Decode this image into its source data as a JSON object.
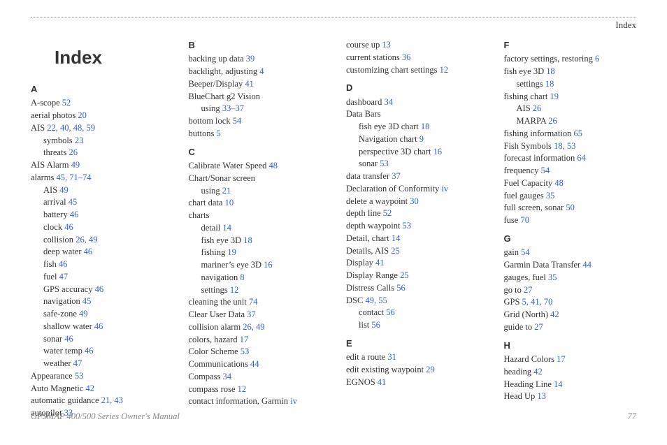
{
  "header": {
    "section": "Index"
  },
  "title": "Index",
  "footer": {
    "left": "GPSMAP 400/500 Series Owner's Manual",
    "right": "77"
  },
  "columns": [
    [
      {
        "type": "title-slot"
      },
      {
        "type": "letter",
        "text": "A"
      },
      {
        "type": "entry",
        "label": "A-scope",
        "pages": "52"
      },
      {
        "type": "entry",
        "label": "aerial photos",
        "pages": "20"
      },
      {
        "type": "entry",
        "label": "AIS",
        "pages": "22, 40, 48, 59"
      },
      {
        "type": "entry",
        "sub": true,
        "label": "symbols",
        "pages": "23"
      },
      {
        "type": "entry",
        "sub": true,
        "label": "threats",
        "pages": "26"
      },
      {
        "type": "entry",
        "label": "AIS Alarm",
        "pages": "49"
      },
      {
        "type": "entry",
        "label": "alarms",
        "pages": "45, 71–74"
      },
      {
        "type": "entry",
        "sub": true,
        "label": "AIS",
        "pages": "49"
      },
      {
        "type": "entry",
        "sub": true,
        "label": "arrival",
        "pages": "45"
      },
      {
        "type": "entry",
        "sub": true,
        "label": "battery",
        "pages": "46"
      },
      {
        "type": "entry",
        "sub": true,
        "label": "clock",
        "pages": "46"
      },
      {
        "type": "entry",
        "sub": true,
        "label": "collision",
        "pages": "26, 49"
      },
      {
        "type": "entry",
        "sub": true,
        "label": "deep water",
        "pages": "46"
      },
      {
        "type": "entry",
        "sub": true,
        "label": "fish",
        "pages": "46"
      },
      {
        "type": "entry",
        "sub": true,
        "label": "fuel",
        "pages": "47"
      },
      {
        "type": "entry",
        "sub": true,
        "label": "GPS accuracy",
        "pages": "46"
      },
      {
        "type": "entry",
        "sub": true,
        "label": "navigation",
        "pages": "45"
      },
      {
        "type": "entry",
        "sub": true,
        "label": "safe-zone",
        "pages": "49"
      },
      {
        "type": "entry",
        "sub": true,
        "label": "shallow water",
        "pages": "46"
      },
      {
        "type": "entry",
        "sub": true,
        "label": "sonar",
        "pages": "46"
      },
      {
        "type": "entry",
        "sub": true,
        "label": "water temp",
        "pages": "46"
      },
      {
        "type": "entry",
        "sub": true,
        "label": "weather",
        "pages": "47"
      },
      {
        "type": "entry",
        "label": "Appearance",
        "pages": "53"
      },
      {
        "type": "entry",
        "label": "Auto Magnetic",
        "pages": "42"
      },
      {
        "type": "entry",
        "label": "automatic guidance",
        "pages": "21, 43"
      },
      {
        "type": "entry",
        "label": "autopilot",
        "pages": "33"
      }
    ],
    [
      {
        "type": "letter",
        "text": "B"
      },
      {
        "type": "entry",
        "label": "backing up data",
        "pages": "39"
      },
      {
        "type": "entry",
        "label": "backlight, adjusting",
        "pages": "4"
      },
      {
        "type": "entry",
        "label": "Beeper/Display",
        "pages": "41"
      },
      {
        "type": "entry",
        "label": "BlueChart g2 Vision",
        "pages": ""
      },
      {
        "type": "entry",
        "sub": true,
        "label": "using",
        "pages": "33–37"
      },
      {
        "type": "entry",
        "label": "bottom lock",
        "pages": "54"
      },
      {
        "type": "entry",
        "label": "buttons",
        "pages": "5"
      },
      {
        "type": "letter",
        "text": "C"
      },
      {
        "type": "entry",
        "label": "Calibrate Water Speed",
        "pages": "48"
      },
      {
        "type": "entry",
        "label": "Chart/Sonar screen",
        "pages": ""
      },
      {
        "type": "entry",
        "sub": true,
        "label": "using",
        "pages": "21"
      },
      {
        "type": "entry",
        "label": "chart data",
        "pages": "10"
      },
      {
        "type": "entry",
        "label": "charts",
        "pages": ""
      },
      {
        "type": "entry",
        "sub": true,
        "label": "detail",
        "pages": "14"
      },
      {
        "type": "entry",
        "sub": true,
        "label": "fish eye 3D",
        "pages": "18"
      },
      {
        "type": "entry",
        "sub": true,
        "label": "fishing",
        "pages": "19"
      },
      {
        "type": "entry",
        "sub": true,
        "label": "mariner’s eye 3D",
        "pages": "16"
      },
      {
        "type": "entry",
        "sub": true,
        "label": "navigation",
        "pages": "8"
      },
      {
        "type": "entry",
        "sub": true,
        "label": "settings",
        "pages": "12"
      },
      {
        "type": "entry",
        "label": "cleaning the unit",
        "pages": "74"
      },
      {
        "type": "entry",
        "label": "Clear User Data",
        "pages": "37"
      },
      {
        "type": "entry",
        "label": "collision alarm",
        "pages": "26, 49"
      },
      {
        "type": "entry",
        "label": "colors, hazard",
        "pages": "17"
      },
      {
        "type": "entry",
        "label": "Color Scheme",
        "pages": "53"
      },
      {
        "type": "entry",
        "label": "Communications",
        "pages": "44"
      },
      {
        "type": "entry",
        "label": "Compass",
        "pages": "34"
      },
      {
        "type": "entry",
        "label": "compass rose",
        "pages": "12"
      },
      {
        "type": "entry",
        "label": "contact information, Garmin",
        "pages": "iv"
      }
    ],
    [
      {
        "type": "entry",
        "label": "course up",
        "pages": "13"
      },
      {
        "type": "entry",
        "label": "current stations",
        "pages": "36"
      },
      {
        "type": "entry",
        "label": "customizing chart settings",
        "pages": "12"
      },
      {
        "type": "letter",
        "text": "D"
      },
      {
        "type": "entry",
        "label": "dashboard",
        "pages": "34"
      },
      {
        "type": "entry",
        "label": "Data Bars",
        "pages": ""
      },
      {
        "type": "entry",
        "sub": true,
        "label": "fish eye 3D chart",
        "pages": "18"
      },
      {
        "type": "entry",
        "sub": true,
        "label": "Navigation chart",
        "pages": "9"
      },
      {
        "type": "entry",
        "sub": true,
        "label": "perspective 3D chart",
        "pages": "16"
      },
      {
        "type": "entry",
        "sub": true,
        "label": "sonar",
        "pages": "53"
      },
      {
        "type": "entry",
        "label": "data transfer",
        "pages": "37"
      },
      {
        "type": "entry",
        "label": "Declaration of Conformity",
        "pages": "iv"
      },
      {
        "type": "entry",
        "label": "delete a waypoint",
        "pages": "30"
      },
      {
        "type": "entry",
        "label": "depth line",
        "pages": "52"
      },
      {
        "type": "entry",
        "label": "depth waypoint",
        "pages": "53"
      },
      {
        "type": "entry",
        "label": "Detail, chart",
        "pages": "14"
      },
      {
        "type": "entry",
        "label": "Details, AIS",
        "pages": "25"
      },
      {
        "type": "entry",
        "label": "Display",
        "pages": "41"
      },
      {
        "type": "entry",
        "label": "Display Range",
        "pages": "25"
      },
      {
        "type": "entry",
        "label": "Distress Calls",
        "pages": "56"
      },
      {
        "type": "entry",
        "label": "DSC",
        "pages": "49, 55"
      },
      {
        "type": "entry",
        "sub": true,
        "label": "contact",
        "pages": "56"
      },
      {
        "type": "entry",
        "sub": true,
        "label": "list",
        "pages": "56"
      },
      {
        "type": "letter",
        "text": "E"
      },
      {
        "type": "entry",
        "label": "edit a route",
        "pages": "31"
      },
      {
        "type": "entry",
        "label": "edit existing waypoint",
        "pages": "29"
      },
      {
        "type": "entry",
        "label": "EGNOS",
        "pages": "41"
      }
    ],
    [
      {
        "type": "letter",
        "text": "F"
      },
      {
        "type": "entry",
        "label": "factory settings, restoring",
        "pages": "6"
      },
      {
        "type": "entry",
        "label": "fish eye 3D",
        "pages": "18"
      },
      {
        "type": "entry",
        "sub": true,
        "label": "settings",
        "pages": "18"
      },
      {
        "type": "entry",
        "label": "fishing chart",
        "pages": "19"
      },
      {
        "type": "entry",
        "sub": true,
        "label": "AIS",
        "pages": "26"
      },
      {
        "type": "entry",
        "sub": true,
        "label": "MARPA",
        "pages": "26"
      },
      {
        "type": "entry",
        "label": "fishing information",
        "pages": "65"
      },
      {
        "type": "entry",
        "label": "Fish Symbols",
        "pages": "18, 53"
      },
      {
        "type": "entry",
        "label": "forecast information",
        "pages": "64"
      },
      {
        "type": "entry",
        "label": "frequency",
        "pages": "54"
      },
      {
        "type": "entry",
        "label": "Fuel Capacity",
        "pages": "48"
      },
      {
        "type": "entry",
        "label": "fuel gauges",
        "pages": "35"
      },
      {
        "type": "entry",
        "label": "full screen, sonar",
        "pages": "50"
      },
      {
        "type": "entry",
        "label": "fuse",
        "pages": "70"
      },
      {
        "type": "letter",
        "text": "G"
      },
      {
        "type": "entry",
        "label": "gain",
        "pages": "54"
      },
      {
        "type": "entry",
        "label": "Garmin Data Transfer",
        "pages": "44"
      },
      {
        "type": "entry",
        "label": "gauges, fuel",
        "pages": "35"
      },
      {
        "type": "entry",
        "label": "go to",
        "pages": "27"
      },
      {
        "type": "entry",
        "label": "GPS",
        "pages": "5, 41, 70"
      },
      {
        "type": "entry",
        "label": "Grid (North)",
        "pages": "42"
      },
      {
        "type": "entry",
        "label": "guide to",
        "pages": "27"
      },
      {
        "type": "letter",
        "text": "H"
      },
      {
        "type": "entry",
        "label": "Hazard Colors",
        "pages": "17"
      },
      {
        "type": "entry",
        "label": "heading",
        "pages": "42"
      },
      {
        "type": "entry",
        "label": "Heading Line",
        "pages": "14"
      },
      {
        "type": "entry",
        "label": "Head Up",
        "pages": "13"
      }
    ]
  ]
}
